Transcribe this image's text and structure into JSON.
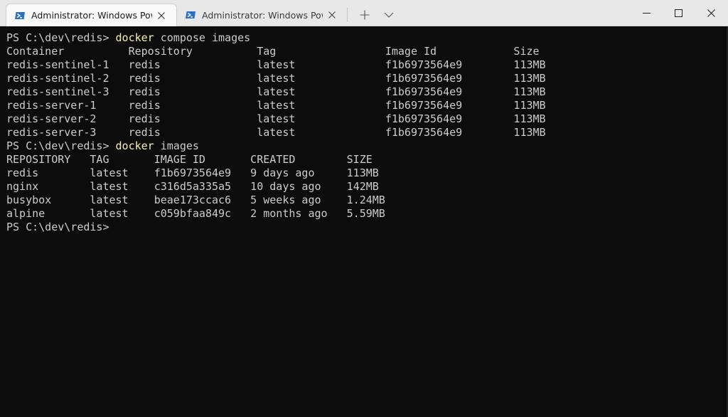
{
  "tabs": [
    {
      "title": "Administrator: Windows PowerShell",
      "active": true,
      "icon": "powershell-icon"
    },
    {
      "title": "Administrator: Windows PowerShell",
      "active": false,
      "icon": "powershell-icon"
    }
  ],
  "colors": {
    "prompt_text": "#cccccc",
    "command_text": "#f9f1a5",
    "terminal_bg": "#0c0c0c",
    "powershell_blue": "#2a6fc9"
  },
  "terminal": {
    "lines": [
      {
        "prompt": "PS C:\\dev\\redis> ",
        "command": "docker",
        "args": " compose images"
      },
      {
        "text": "Container          Repository          Tag                 Image Id            Size"
      },
      {
        "text": "redis-sentinel-1   redis               latest              f1b6973564e9        113MB"
      },
      {
        "text": "redis-sentinel-2   redis               latest              f1b6973564e9        113MB"
      },
      {
        "text": "redis-sentinel-3   redis               latest              f1b6973564e9        113MB"
      },
      {
        "text": "redis-server-1     redis               latest              f1b6973564e9        113MB"
      },
      {
        "text": "redis-server-2     redis               latest              f1b6973564e9        113MB"
      },
      {
        "text": "redis-server-3     redis               latest              f1b6973564e9        113MB"
      },
      {
        "prompt": "PS C:\\dev\\redis> ",
        "command": "docker",
        "args": " images"
      },
      {
        "text": "REPOSITORY   TAG       IMAGE ID       CREATED        SIZE"
      },
      {
        "text": "redis        latest    f1b6973564e9   9 days ago     113MB"
      },
      {
        "text": "nginx        latest    c316d5a335a5   10 days ago    142MB"
      },
      {
        "text": "busybox      latest    beae173ccac6   5 weeks ago    1.24MB"
      },
      {
        "text": "alpine       latest    c059bfaa849c   2 months ago   5.59MB"
      },
      {
        "prompt": "PS C:\\dev\\redis> ",
        "command": "",
        "args": ""
      }
    ]
  }
}
